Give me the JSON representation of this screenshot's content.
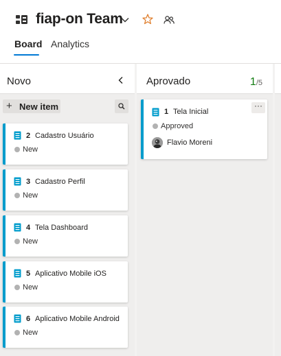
{
  "header": {
    "team_name": "fiap-on Team",
    "tabs": [
      {
        "label": "Board",
        "active": true
      },
      {
        "label": "Analytics",
        "active": false
      }
    ],
    "icons": [
      "team-icon",
      "chevron-down-icon",
      "star-icon",
      "team-members-icon"
    ]
  },
  "columns": {
    "novo": {
      "title": "Novo",
      "new_item_label": "New item",
      "cards": [
        {
          "id": "2",
          "title": "Cadastro Usuário",
          "state": "New"
        },
        {
          "id": "3",
          "title": "Cadastro Perfil",
          "state": "New"
        },
        {
          "id": "4",
          "title": "Tela Dashboard",
          "state": "New"
        },
        {
          "id": "5",
          "title": "Aplicativo Mobile iOS",
          "state": "New"
        },
        {
          "id": "6",
          "title": "Aplicativo Mobile Android",
          "state": "New"
        }
      ]
    },
    "aprovado": {
      "title": "Aprovado",
      "wip_count": "1",
      "wip_limit": "/5",
      "cards": [
        {
          "id": "1",
          "title": "Tela Inicial",
          "state": "Approved",
          "assignee": "Flavio Moreni",
          "more_label": "···"
        }
      ]
    }
  },
  "colors": {
    "accent": "#0078d4",
    "card_stripe": "#009ccc",
    "wip_ok": "#107c10",
    "state_dot": "#b2b2b2",
    "star": "#e08030"
  }
}
